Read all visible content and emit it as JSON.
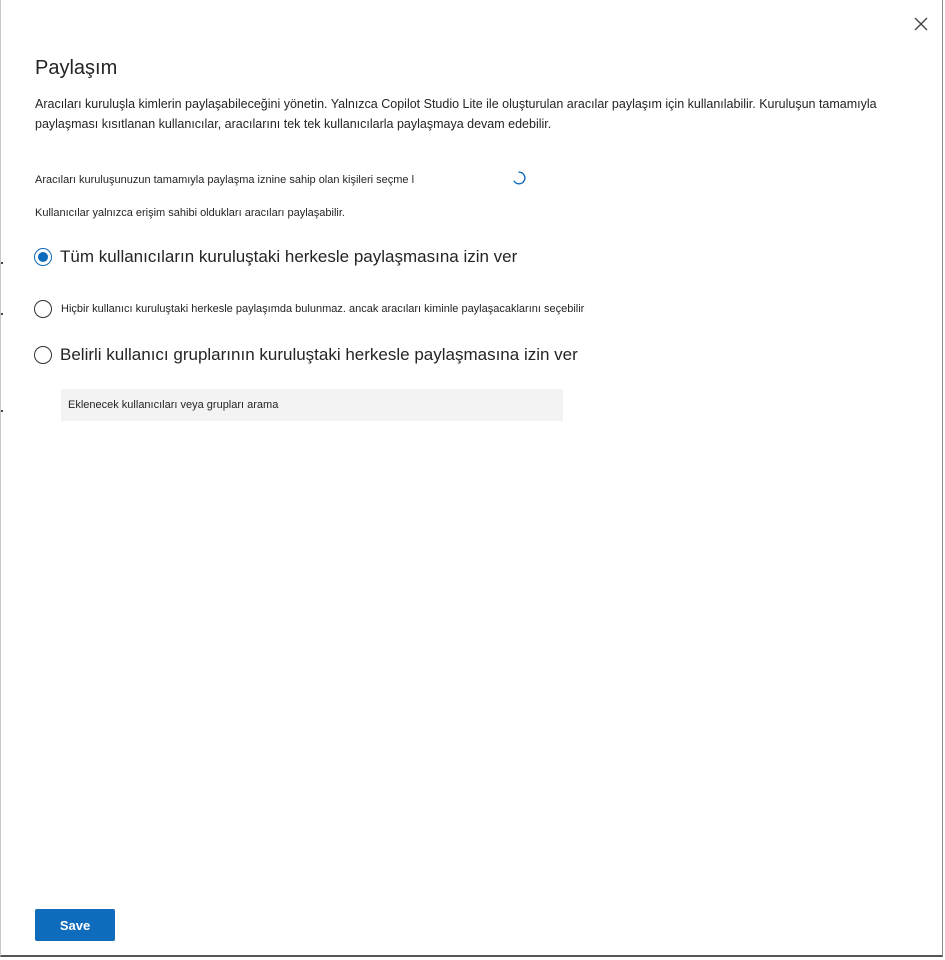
{
  "panel": {
    "title": "Paylaşım",
    "description": "Aracıları kuruluşla kimlerin paylaşabileceğini yönetin. Yalnızca Copilot Studio Lite ile oluşturulan aracılar paylaşım için kullanılabilir. Kuruluşun tamamıyla paylaşması kısıtlanan kullanıcılar, aracılarını tek tek kullanıcılarla paylaşmaya devam edebilir.",
    "select_label": "Aracıları kuruluşunuzun tamamıyla paylaşma iznine sahip olan kişileri seçme l",
    "note": "Kullanıcılar yalnızca erişim sahibi oldukları aracıları paylaşabilir.",
    "close_icon": "close-icon",
    "spinner_icon": "loading-spinner-icon"
  },
  "options": [
    {
      "label": "Tüm kullanıcıların kuruluştaki herkesle paylaşmasına izin ver",
      "checked": true
    },
    {
      "label": "Hiçbir kullanıcı kuruluştaki herkesle paylaşımda bulunmaz. ancak aracıları kiminle paylaşacaklarını seçebilir",
      "checked": false
    },
    {
      "label": "Belirli kullanıcı gruplarının kuruluştaki herkesle paylaşmasına izin ver",
      "checked": false
    }
  ],
  "search": {
    "placeholder": "Eklenecek kullanıcıları veya grupları arama",
    "value": ""
  },
  "footer": {
    "save_label": "Save"
  },
  "colors": {
    "accent": "#0f6cbd",
    "search_bg": "#f3f3f3",
    "text": "#242424"
  }
}
